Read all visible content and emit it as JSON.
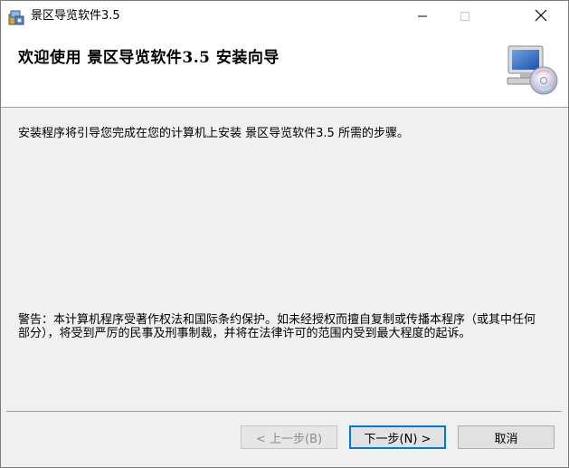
{
  "window": {
    "title": "景区导览软件3.5"
  },
  "header": {
    "title": "欢迎使用 景区导览软件3.5 安装向导"
  },
  "content": {
    "intro": "安装程序将引导您完成在您的计算机上安装 景区导览软件3.5 所需的步骤。",
    "warning": "警告：本计算机程序受著作权法和国际条约保护。如未经授权而擅自复制或传播本程序（或其中任何部分），将受到严厉的民事及刑事制裁，并将在法律许可的范围内受到最大程度的起诉。"
  },
  "buttons": {
    "prev": "< 上一步(B)",
    "next": "下一步(N) >",
    "cancel": "取消"
  },
  "colors": {
    "accent": "#0078d7",
    "header_bg": "#ffffff",
    "body_bg": "#f0f0f0"
  },
  "icons": {
    "app": "installer-package-icon",
    "header": "computer-disc-icon"
  }
}
